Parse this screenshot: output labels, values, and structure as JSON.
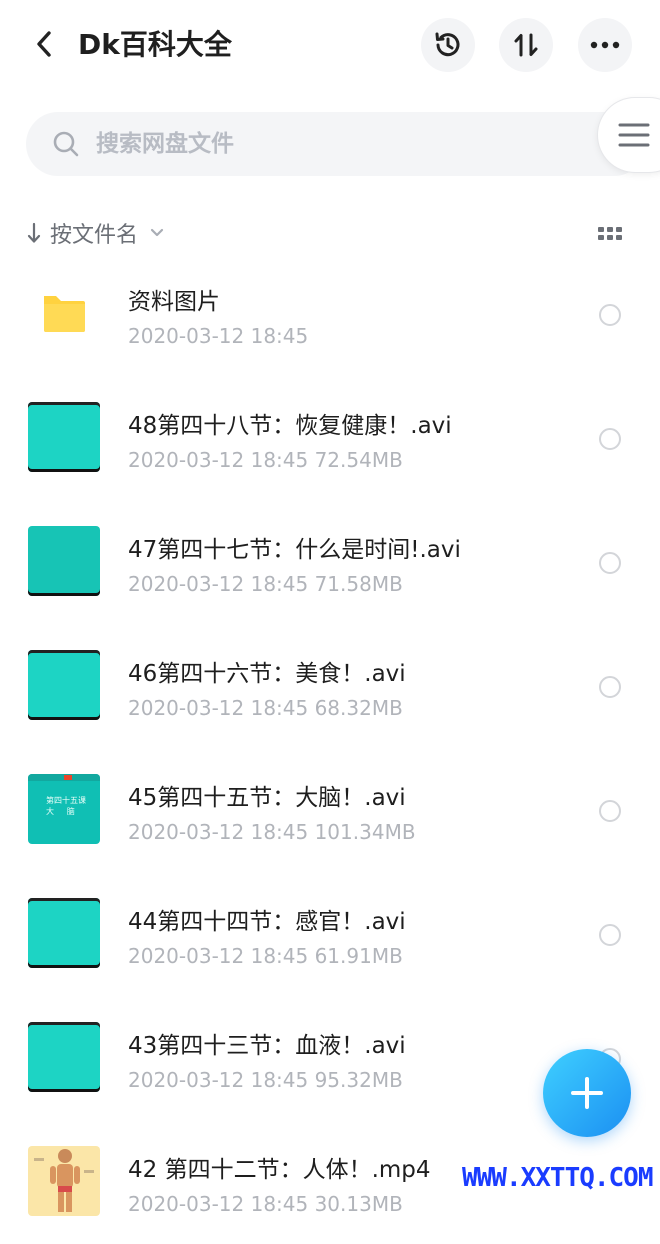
{
  "header": {
    "title": "Dk百科大全"
  },
  "search": {
    "placeholder": "搜索网盘文件"
  },
  "sort": {
    "label": "按文件名"
  },
  "files": [
    {
      "name": "资料图片",
      "meta": "2020-03-12  18:45",
      "type": "folder"
    },
    {
      "name": "48第四十八节：恢复健康！.avi",
      "meta": "2020-03-12  18:45  72.54MB",
      "type": "video"
    },
    {
      "name": "47第四十七节：什么是时间!.avi",
      "meta": "2020-03-12  18:45  71.58MB",
      "type": "video"
    },
    {
      "name": "46第四十六节：美食！.avi",
      "meta": "2020-03-12  18:45  68.32MB",
      "type": "video"
    },
    {
      "name": "45第四十五节：大脑！.avi",
      "meta": "2020-03-12  18:45  101.34MB",
      "type": "video-thumb"
    },
    {
      "name": "44第四十四节：感官！.avi",
      "meta": "2020-03-12  18:45  61.91MB",
      "type": "video"
    },
    {
      "name": "43第四十三节：血液！.avi",
      "meta": "2020-03-12  18:45  95.32MB",
      "type": "video"
    },
    {
      "name": "42 第四十二节：人体！.mp4",
      "meta": "2020-03-12  18:45  30.13MB",
      "type": "image-thumb"
    }
  ],
  "thumb45": {
    "line1": "第四十五课",
    "line2": "大     脑"
  },
  "watermark": "WWW.XXTTQ.COM",
  "colors": {
    "accent": "#1b8ff2",
    "folder": "#ffd23f",
    "video_thumb": "#1dd4c4"
  }
}
